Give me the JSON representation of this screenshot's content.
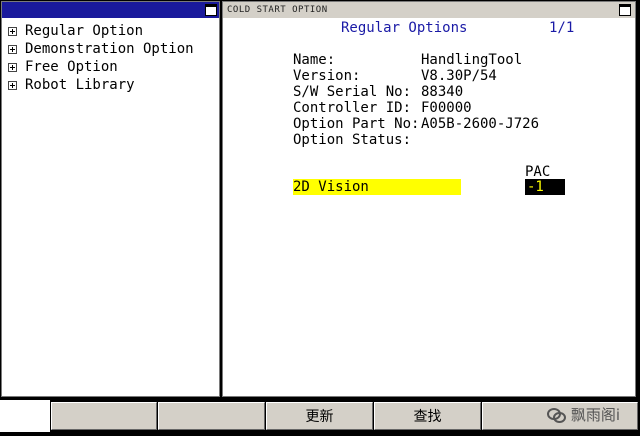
{
  "left_pane": {
    "tree_items": [
      {
        "label": "Regular Option"
      },
      {
        "label": "Demonstration Option"
      },
      {
        "label": "Free Option"
      },
      {
        "label": "Robot Library"
      }
    ]
  },
  "right_pane": {
    "window_title": "COLD START OPTION",
    "header": {
      "title": "Regular Options",
      "page": "1/1"
    },
    "info": [
      {
        "label": "Name:",
        "value": "HandlingTool"
      },
      {
        "label": "Version:",
        "value": "V8.30P/54"
      },
      {
        "label": "S/W Serial No:",
        "value": "88340"
      },
      {
        "label": "Controller ID:",
        "value": "F00000"
      },
      {
        "label": "Option Part No:",
        "value": "A05B-2600-J726"
      },
      {
        "label": "Option Status:",
        "value": ""
      }
    ],
    "column_header": "PAC",
    "options": [
      {
        "name": "2D Vision",
        "value": "-1"
      }
    ]
  },
  "function_keys": [
    "",
    "",
    "更新",
    "查找",
    ""
  ],
  "watermark": {
    "text": "飘雨阁i",
    "icon": "wechat-icon"
  },
  "colors": {
    "title_blue": "#1a1a9c",
    "highlight_yellow": "#ffff00",
    "text_blue": "#1a1aa6"
  }
}
